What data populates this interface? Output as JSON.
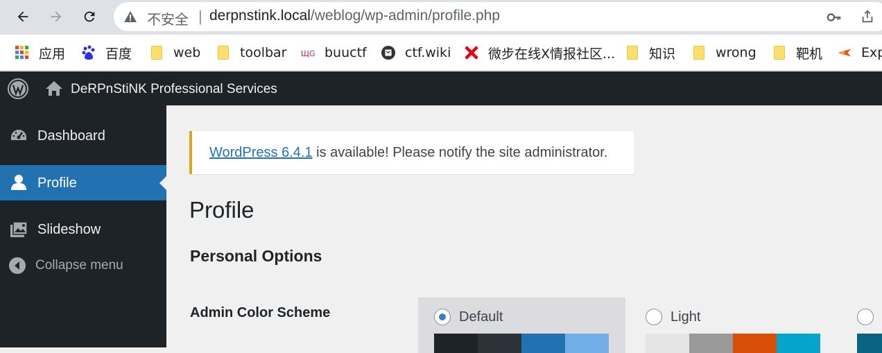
{
  "browser": {
    "insecure_label": "不安全",
    "separator": "|",
    "url_host": "derpnstink.local",
    "url_path": "/weblog/wp-admin/profile.php"
  },
  "bookmarks": [
    {
      "label": "应用",
      "icon": "apps-grid-icon"
    },
    {
      "label": "百度",
      "icon": "baidu-icon"
    },
    {
      "label": "web",
      "icon": "folder-icon"
    },
    {
      "label": "toolbar",
      "icon": "folder-icon"
    },
    {
      "label": "buuctf",
      "icon": "buuctf-icon"
    },
    {
      "label": "ctf.wiki",
      "icon": "ctfwiki-icon"
    },
    {
      "label": "微步在线X情报社区...",
      "icon": "threatbook-icon"
    },
    {
      "label": "知识",
      "icon": "folder-icon"
    },
    {
      "label": "wrong",
      "icon": "folder-icon"
    },
    {
      "label": "靶机",
      "icon": "folder-icon"
    },
    {
      "label": "Exp",
      "icon": "exploit-icon"
    }
  ],
  "adminbar": {
    "site_name": "DeRPnStiNK Professional Services"
  },
  "sidebar": {
    "items": [
      {
        "label": "Dashboard",
        "icon": "dashboard-icon"
      },
      {
        "label": "Profile",
        "icon": "user-icon"
      },
      {
        "label": "Slideshow",
        "icon": "slideshow-icon"
      },
      {
        "label": "Collapse menu",
        "icon": "collapse-icon"
      }
    ]
  },
  "notice": {
    "link_text": "WordPress 6.4.1",
    "message": " is available! Please notify the site administrator."
  },
  "main": {
    "page_title": "Profile",
    "section_title": "Personal Options",
    "admin_color_label": "Admin Color Scheme",
    "color_schemes": [
      {
        "label": "Default",
        "selected": true,
        "colors": [
          "#1d2327",
          "#2c3338",
          "#2271b1",
          "#72aee6"
        ]
      },
      {
        "label": "Light",
        "selected": false,
        "colors": [
          "#e5e5e5",
          "#999999",
          "#d64e07",
          "#04a4cc"
        ]
      },
      {
        "label": "",
        "selected": false,
        "colors": [
          "#096484"
        ]
      }
    ]
  },
  "colors": {
    "admin_bar": "#1d2327",
    "accent": "#2271b1",
    "notice_border": "#dba617"
  }
}
